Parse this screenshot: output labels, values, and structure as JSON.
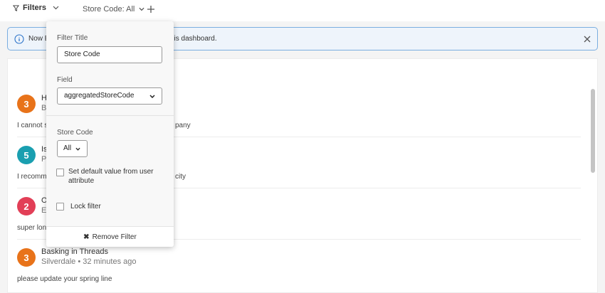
{
  "topbar": {
    "filters_label": "Filters",
    "chip_label": "Store Code: All"
  },
  "banner": {
    "text_left": "Now E",
    "text_right": "his dashboard."
  },
  "reviews": [
    {
      "score": "3",
      "color": "#e8731a",
      "title": "H",
      "subtitle": "B",
      "body_left": "I cannot st",
      "body_right": "pany"
    },
    {
      "score": "5",
      "color": "#1a9fb0",
      "title": "Is",
      "subtitle": "P",
      "body_left": "I recomme",
      "body_right": "city"
    },
    {
      "score": "2",
      "color": "#e23f57",
      "title": "O",
      "subtitle": "E",
      "body_left": "super long",
      "body_right": ""
    },
    {
      "score": "3",
      "color": "#e8731a",
      "title": "Basking in Threads",
      "subtitle": "Silverdale • 32 minutes ago",
      "body_left": "please update your spring line",
      "body_right": ""
    }
  ],
  "popover": {
    "filter_title_label": "Filter Title",
    "filter_title_value": "Store Code",
    "field_label": "Field",
    "field_value": "aggregatedStoreCode",
    "store_code_label": "Store Code",
    "store_code_value": "All",
    "default_attr_label": "Set default value from user attribute",
    "lock_label": "Lock filter",
    "remove_label": "Remove Filter"
  }
}
